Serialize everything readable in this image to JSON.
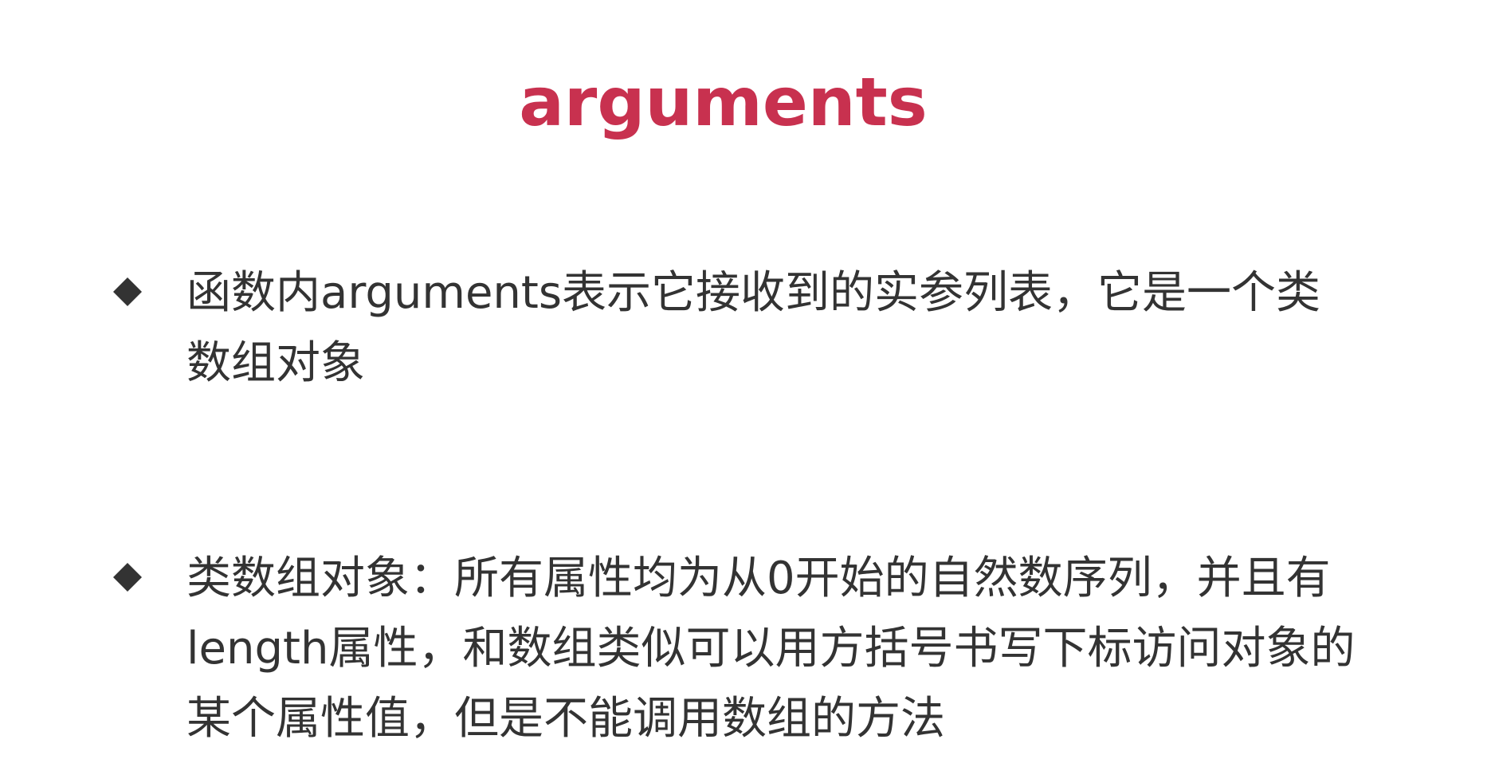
{
  "slide": {
    "title": "arguments",
    "bullets": [
      {
        "line1": "函数内arguments表示它接收到的实参列表，它是一个类",
        "line2": "数组对象"
      },
      {
        "line1": "类数组对象：所有属性均为从0开始的自然数序列，并且有",
        "line2": "length属性，和数组类似可以用方括号书写下标访问对象的",
        "line3": "某个属性值，但是不能调用数组的方法"
      }
    ]
  },
  "colors": {
    "title": "#c8314f",
    "text": "#333333",
    "bullet": "#333333",
    "background": "#ffffff"
  },
  "icons": {
    "bullet": "diamond-icon"
  }
}
